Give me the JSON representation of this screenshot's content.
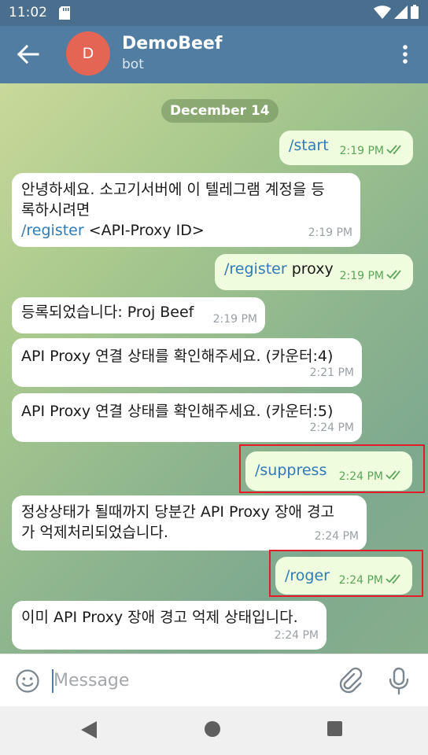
{
  "status": {
    "time": "11:02"
  },
  "header": {
    "title": "DemoBeef",
    "subtitle": "bot",
    "avatar_letter": "D"
  },
  "chat": {
    "date": "December 14",
    "messages": [
      {
        "dir": "out",
        "cmd": "/start",
        "text": "",
        "time": "2:19 PM",
        "read": true
      },
      {
        "dir": "in",
        "lines": [
          "안녕하세요. 소고기서버에 이 텔레그램 계정을 등",
          "록하시려면"
        ],
        "cmd": "/register",
        "text": " <API-Proxy ID>",
        "time": "2:19 PM"
      },
      {
        "dir": "out",
        "cmd": "/register",
        "text": " proxy",
        "time": "2:19 PM",
        "read": true
      },
      {
        "dir": "in",
        "text": "등록되었습니다: Proj Beef",
        "time": "2:19 PM"
      },
      {
        "dir": "in",
        "text": "API Proxy 연결 상태를 확인해주세요. (카운터:4)",
        "time": "2:21 PM"
      },
      {
        "dir": "in",
        "text": "API Proxy 연결 상태를 확인해주세요. (카운터:5)",
        "time": "2:24 PM"
      },
      {
        "dir": "out",
        "cmd": "/suppress",
        "text": "",
        "time": "2:24 PM",
        "read": true
      },
      {
        "dir": "in",
        "lines": [
          "정상상태가 될때까지 당분간 API Proxy 장애 경고",
          "가 억제처리되었습니다."
        ],
        "time": "2:24 PM"
      },
      {
        "dir": "out",
        "cmd": "/roger",
        "text": "",
        "time": "2:24 PM",
        "read": true
      },
      {
        "dir": "in",
        "text": "이미 API Proxy 장애 경고 억제 상태입니다.",
        "time": "2:24 PM"
      }
    ]
  },
  "composer": {
    "placeholder": "Message",
    "value": ""
  },
  "colors": {
    "header": "#527da3",
    "statusbar": "#4a6e8e",
    "highlight": "#e11d2a",
    "command_link": "#2f7ab8",
    "read_check": "#5aa65a"
  }
}
